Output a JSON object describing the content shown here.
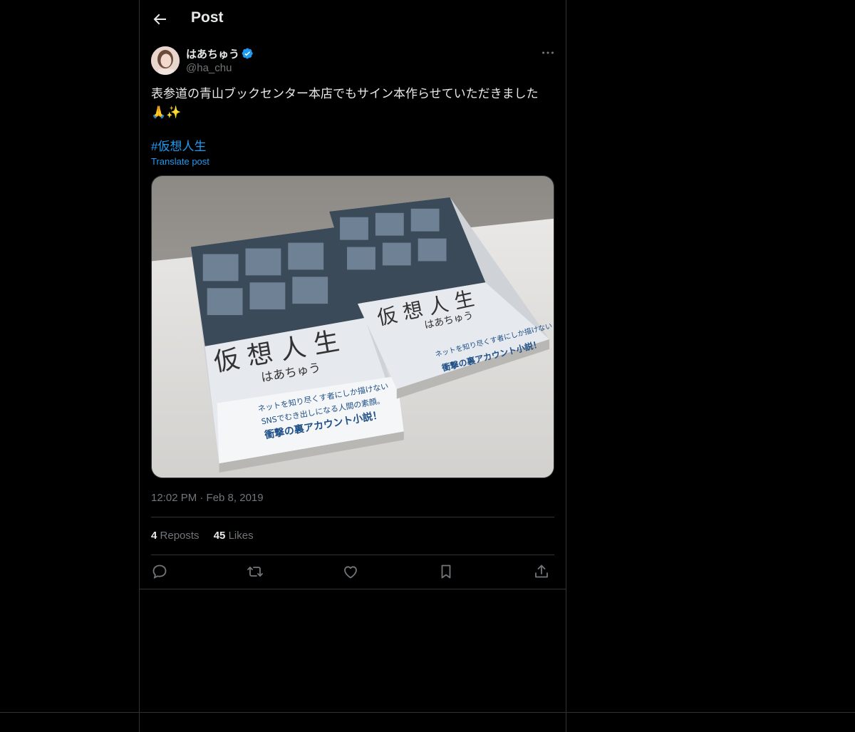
{
  "header": {
    "title": "Post"
  },
  "author": {
    "name": "はあちゅう",
    "handle": "@ha_chu",
    "verified": true
  },
  "post": {
    "text": "表参道の青山ブックセンター本店でもサイン本作らせていただきました🙏✨",
    "hashtag": "#仮想人生",
    "translate_label": "Translate post",
    "timestamp": "12:02 PM · Feb 8, 2019"
  },
  "stats": {
    "reposts_count": "4",
    "reposts_label": "Reposts",
    "likes_count": "45",
    "likes_label": "Likes"
  },
  "media": {
    "book_title": "仮 想 人 生",
    "book_author": "はあちゅう",
    "obi_line1": "ネットを知り尽くす者にしか描けない",
    "obi_line2": "SNSでむき出しになる人間の素顔。",
    "obi_line3": "衝撃の裏アカウント小説！"
  },
  "icons": {
    "back": "back-arrow-icon",
    "more": "more-icon",
    "reply": "reply-icon",
    "repost": "repost-icon",
    "like": "like-icon",
    "bookmark": "bookmark-icon",
    "share": "share-icon"
  },
  "colors": {
    "accent": "#1d9bf0",
    "background": "#000000",
    "muted": "#71767b",
    "divider": "#2f3336"
  }
}
